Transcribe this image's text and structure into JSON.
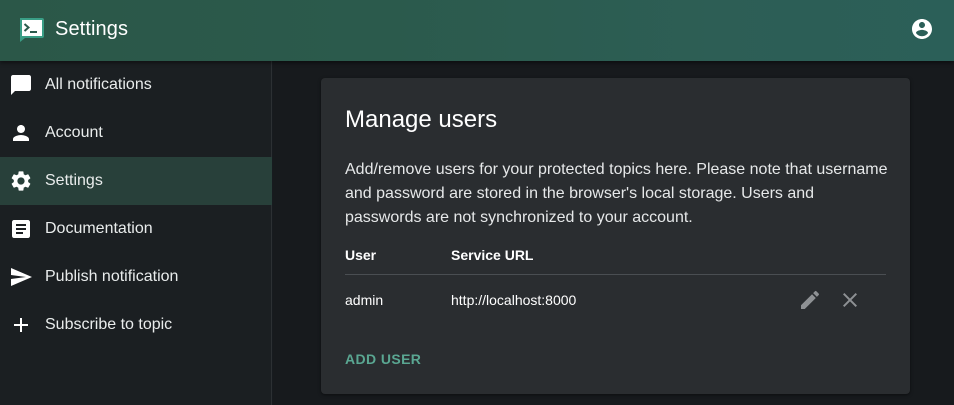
{
  "app": {
    "title": "Settings",
    "logo_icon": "terminal-icon",
    "account_icon": "account-circle-icon"
  },
  "sidebar": {
    "items": [
      {
        "label": "All notifications",
        "icon": "chat-bubble-icon",
        "selected": false
      },
      {
        "label": "Account",
        "icon": "person-icon",
        "selected": false
      },
      {
        "label": "Settings",
        "icon": "gear-icon",
        "selected": true
      },
      {
        "label": "Documentation",
        "icon": "article-icon",
        "selected": false
      },
      {
        "label": "Publish notification",
        "icon": "send-icon",
        "selected": false
      },
      {
        "label": "Subscribe to topic",
        "icon": "plus-icon",
        "selected": false
      }
    ]
  },
  "manage_users": {
    "title": "Manage users",
    "description": "Add/remove users for your protected topics here. Please note that username and password are stored in the browser's local storage. Users and passwords are not synchronized to your account.",
    "columns": {
      "user": "User",
      "service_url": "Service URL"
    },
    "rows": [
      {
        "user": "admin",
        "service_url": "http://localhost:8000"
      }
    ],
    "add_user_label": "ADD USER"
  },
  "colors": {
    "accent": "#5aa792",
    "appbar": "#2b5a4c",
    "selected_nav": "#28403a",
    "card": "#2a2d30"
  }
}
